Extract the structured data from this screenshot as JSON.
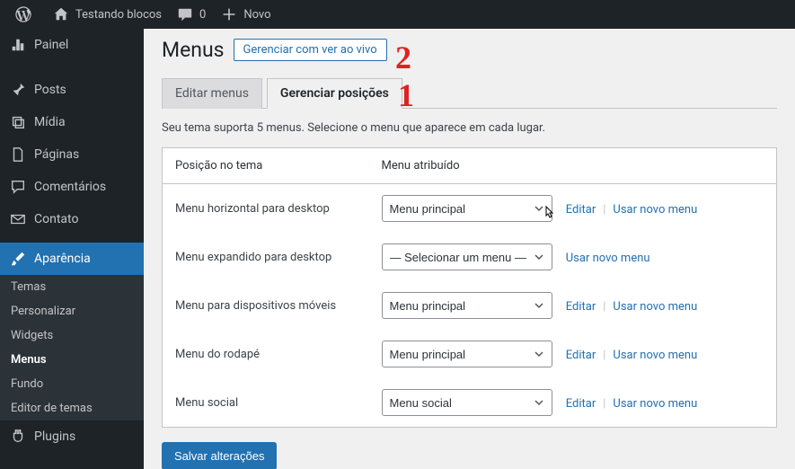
{
  "toolbar": {
    "site_name": "Testando blocos",
    "comments_count": "0",
    "new_label": "Novo"
  },
  "sidebar": {
    "items": [
      {
        "label": "Painel",
        "icon": "dashboard"
      },
      {
        "label": "Posts",
        "icon": "pin"
      },
      {
        "label": "Mídia",
        "icon": "media"
      },
      {
        "label": "Páginas",
        "icon": "page"
      },
      {
        "label": "Comentários",
        "icon": "comment"
      },
      {
        "label": "Contato",
        "icon": "mail"
      },
      {
        "label": "Aparência",
        "icon": "brush"
      },
      {
        "label": "Plugins",
        "icon": "plug"
      }
    ],
    "submenu": [
      "Temas",
      "Personalizar",
      "Widgets",
      "Menus",
      "Fundo",
      "Editor de temas"
    ]
  },
  "page": {
    "title": "Menus",
    "live_link": "Gerenciar com ver ao vivo"
  },
  "tabs": {
    "edit": "Editar menus",
    "manage": "Gerenciar posições"
  },
  "description": "Seu tema suporta 5 menus. Selecione o menu que aparece em cada lugar.",
  "table": {
    "header_position": "Posição no tema",
    "header_menu": "Menu atribuído",
    "rows": [
      {
        "position": "Menu horizontal para desktop",
        "selected": "Menu principal",
        "edit": true
      },
      {
        "position": "Menu expandido para desktop",
        "selected": "— Selecionar um menu —",
        "edit": false
      },
      {
        "position": "Menu para dispositivos móveis",
        "selected": "Menu principal",
        "edit": true
      },
      {
        "position": "Menu do rodapé",
        "selected": "Menu principal",
        "edit": true
      },
      {
        "position": "Menu social",
        "selected": "Menu social",
        "edit": true
      }
    ]
  },
  "actions": {
    "edit": "Editar",
    "use_new": "Usar novo menu",
    "save": "Salvar alterações"
  },
  "annotations": {
    "one": "1",
    "two": "2"
  }
}
